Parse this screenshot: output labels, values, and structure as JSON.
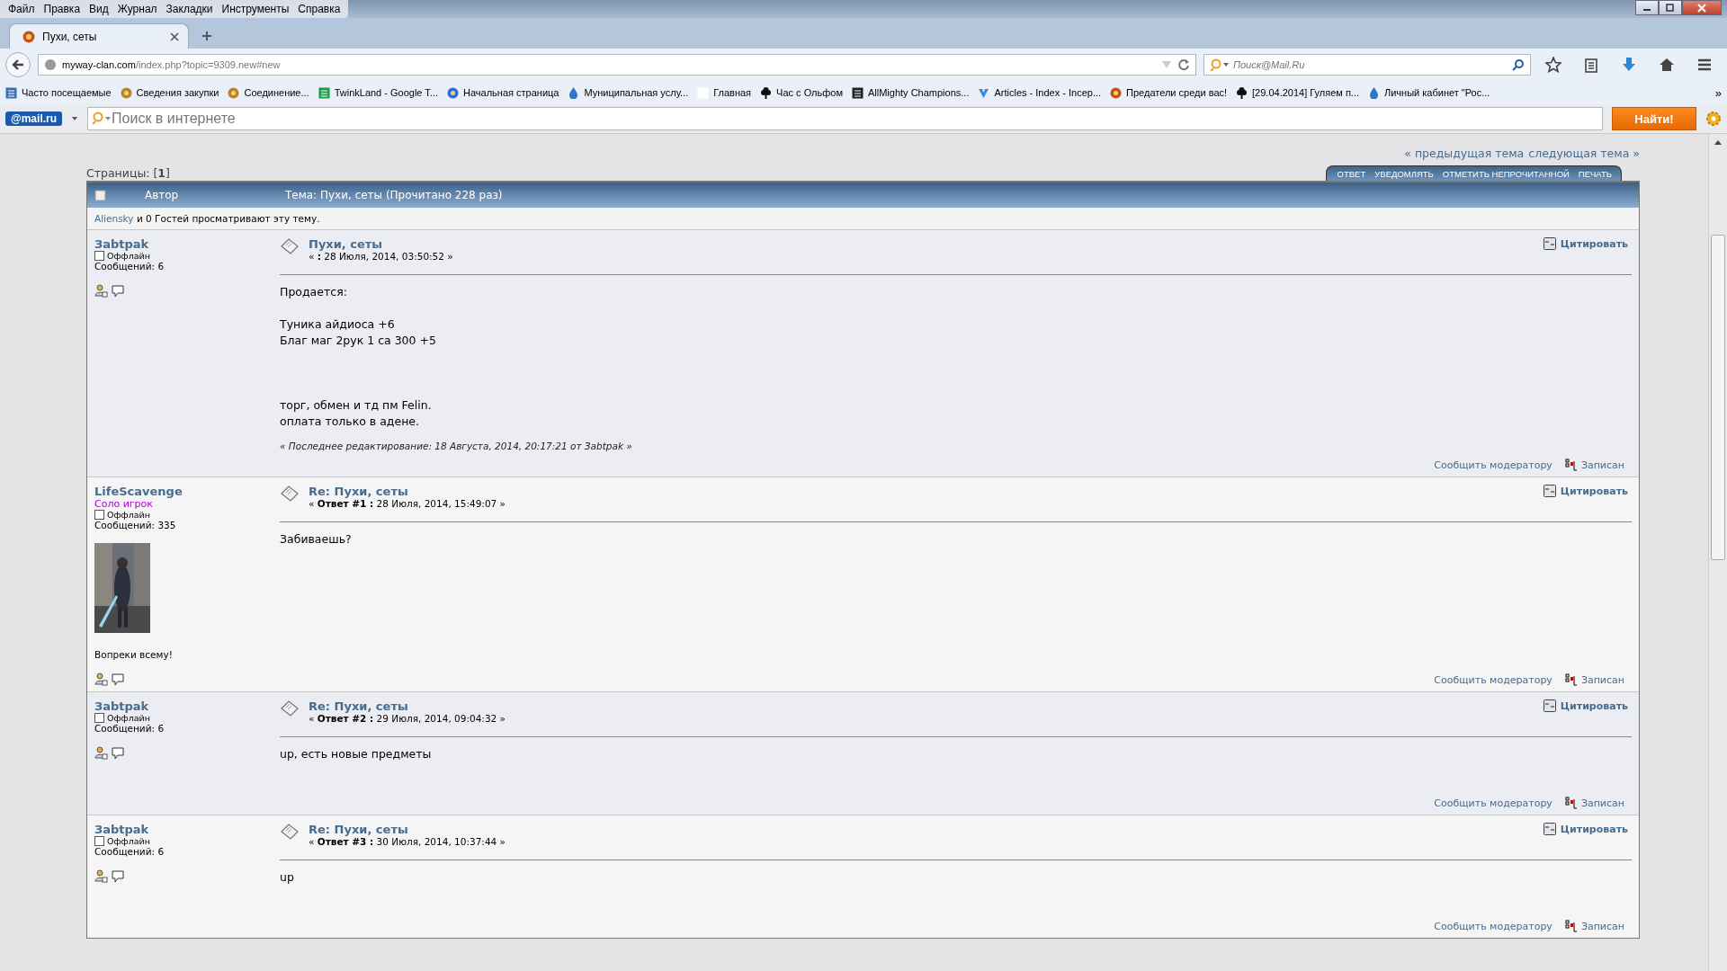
{
  "menu": [
    "Файл",
    "Правка",
    "Вид",
    "Журнал",
    "Закладки",
    "Инструменты",
    "Справка"
  ],
  "tab": {
    "title": "Пухи, сеты",
    "selected": true
  },
  "address": {
    "domain": "myway-clan.com",
    "path": "/index.php?topic=9309.new#new"
  },
  "browser_search": {
    "placeholder": "Поиск@Mail.Ru"
  },
  "bookmarks": [
    {
      "label": "Часто посещаемые",
      "kind": "folder"
    },
    {
      "label": "Сведения закупки",
      "kind": "emblem"
    },
    {
      "label": "Соединение...",
      "kind": "emblem"
    },
    {
      "label": "TwinkLand - Google T...",
      "kind": "sheet"
    },
    {
      "label": "Начальная страница",
      "kind": "at"
    },
    {
      "label": "Муниципальная услу...",
      "kind": "drop"
    },
    {
      "label": "Главная",
      "kind": "blank"
    },
    {
      "label": "Час с Ольфом",
      "kind": "clover"
    },
    {
      "label": "AllMighty Champions...",
      "kind": "letter"
    },
    {
      "label": "Articles - Index - Incep...",
      "kind": "check"
    },
    {
      "label": "Предатели среди вас!",
      "kind": "emblem2"
    },
    {
      "label": "[29.04.2014] Гуляем п...",
      "kind": "clover"
    },
    {
      "label": "Личный кабинет \"Рос...",
      "kind": "drop"
    }
  ],
  "more_bookmarks": "»",
  "mail_bar": {
    "logo": "@mail.ru",
    "placeholder": "Поиск в интернете",
    "button": "Найти!"
  },
  "forum": {
    "prev_topic": "« предыдущая тема",
    "next_topic": "следующая тема »",
    "pages": "Страницы: [**1**]",
    "actions": [
      "ОТВЕТ",
      "УВЕДОМЛЯТЬ",
      "ОТМЕТИТЬ НЕПРОЧИТАННОЙ",
      "ПЕЧАТЬ"
    ],
    "author_header": "Автор",
    "topic_header": "Тема: Пухи, сеты  (Прочитано 228 раз)",
    "viewer": "Aliensky",
    "viewers_text": "и 0 Гостей просматривают эту тему.",
    "posts": [
      {
        "author": "Зabtpak",
        "status": "Оффлайн",
        "online": false,
        "post_count": "Сообщений: 6",
        "title": "Пухи, сеты",
        "meta": "« **:** 28 Июля, 2014, 03:50:52 »",
        "quote": "Цитировать",
        "body": [
          [
            "Продается:"
          ],
          [
            "Туника айдиоса +6",
            "Благ маг 2рук 1 са 300 +5"
          ],
          [
            "торг, обмен и тд пм Felin.",
            "оплата только в адене."
          ]
        ],
        "edited": "« Последнее редактирование: 18 Августа, 2014, 20:17:21 от Зabtpak »",
        "report": "Сообщить модератору",
        "logged": "Записан"
      },
      {
        "author": "LifeScavenge",
        "rank": "Соло игрок",
        "status": "Оффлайн",
        "online": false,
        "post_count": "Сообщений: 335",
        "avatar": {
          "kind": "picture"
        },
        "signature": "Вопреки всему!",
        "title": "Re: Пухи, сеты",
        "meta": "« **Ответ #1 :** 28 Июля, 2014, 15:49:07 »",
        "quote": "Цитировать",
        "body": [
          [
            "Забиваешь?"
          ]
        ],
        "report": "Сообщить модератору",
        "logged": "Записан"
      },
      {
        "author": "Зabtpak",
        "status": "Оффлайн",
        "online": false,
        "post_count": "Сообщений: 6",
        "title": "Re: Пухи, сеты",
        "meta": "« **Ответ #2 :** 29 Июля, 2014, 09:04:32 »",
        "quote": "Цитировать",
        "body": [
          [
            "up, есть новые предметы"
          ]
        ],
        "report": "Сообщить модератору",
        "logged": "Записан"
      },
      {
        "author": "Зabtpak",
        "status": "Оффлайн",
        "online": false,
        "post_count": "Сообщений: 6",
        "title": "Re: Пухи, сеты",
        "meta": "« **Ответ #3 :** 30 Июля, 2014, 10:37:44 »",
        "quote": "Цитировать",
        "body": [
          [
            "up"
          ]
        ],
        "report": "Сообщить модератору",
        "logged": "Записан"
      }
    ]
  }
}
